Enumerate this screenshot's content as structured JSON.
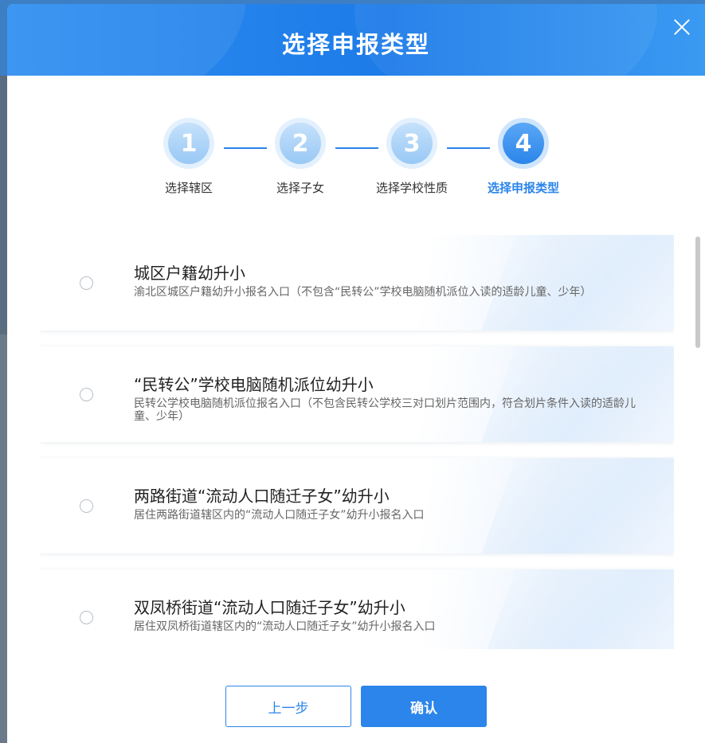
{
  "modal": {
    "title": "选择申报类型"
  },
  "steps": [
    {
      "number": "1",
      "label": "选择辖区"
    },
    {
      "number": "2",
      "label": "选择子女"
    },
    {
      "number": "3",
      "label": "选择学校性质"
    },
    {
      "number": "4",
      "label": "选择申报类型"
    }
  ],
  "active_step": 4,
  "options": [
    {
      "title": "城区户籍幼升小",
      "desc": "渝北区城区户籍幼升小报名入口（不包含“民转公”学校电脑随机派位入读的适龄儿童、少年）"
    },
    {
      "title": "“民转公”学校电脑随机派位幼升小",
      "desc": "民转公学校电脑随机派位报名入口（不包含民转公学校三对口划片范围内，符合划片条件入读的适龄儿童、少年）"
    },
    {
      "title": "两路街道“流动人口随迁子女”幼升小",
      "desc": "居住两路街道辖区内的“流动人口随迁子女”幼升小报名入口"
    },
    {
      "title": "双凤桥街道“流动人口随迁子女”幼升小",
      "desc": "居住双凤桥街道辖区内的“流动人口随迁子女”幼升小报名入口"
    }
  ],
  "footer": {
    "prev_label": "上一步",
    "confirm_label": "确认"
  },
  "colors": {
    "primary": "#2b85ea",
    "header_gradient_start": "#2f8ef0",
    "step_inactive": "#98c8f5"
  }
}
